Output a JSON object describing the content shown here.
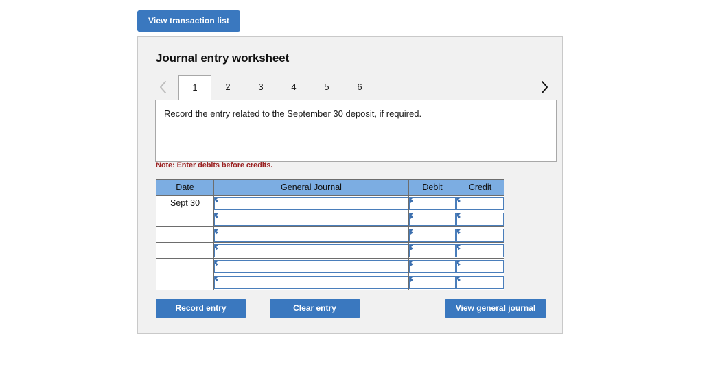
{
  "toolbar": {
    "view_transaction_list_label": "View transaction list"
  },
  "panel": {
    "title": "Journal entry worksheet",
    "note": "Note: Enter debits before credits."
  },
  "tabs": {
    "prev_icon": "chevron-left-icon",
    "next_icon": "chevron-right-icon",
    "items": [
      {
        "label": "1",
        "active": true
      },
      {
        "label": "2",
        "active": false
      },
      {
        "label": "3",
        "active": false
      },
      {
        "label": "4",
        "active": false
      },
      {
        "label": "5",
        "active": false
      },
      {
        "label": "6",
        "active": false
      }
    ]
  },
  "instruction": {
    "text": "Record the entry related to the September 30 deposit, if required."
  },
  "table": {
    "headers": [
      "Date",
      "General Journal",
      "Debit",
      "Credit"
    ],
    "rows": [
      {
        "date": "Sept 30",
        "general_journal": "",
        "debit": "",
        "credit": ""
      },
      {
        "date": "",
        "general_journal": "",
        "debit": "",
        "credit": ""
      },
      {
        "date": "",
        "general_journal": "",
        "debit": "",
        "credit": ""
      },
      {
        "date": "",
        "general_journal": "",
        "debit": "",
        "credit": ""
      },
      {
        "date": "",
        "general_journal": "",
        "debit": "",
        "credit": ""
      },
      {
        "date": "",
        "general_journal": "",
        "debit": "",
        "credit": ""
      }
    ]
  },
  "actions": {
    "record_entry_label": "Record entry",
    "clear_entry_label": "Clear entry",
    "view_general_journal_label": "View general journal"
  },
  "colors": {
    "button_blue": "#3a78bf",
    "table_header_blue": "#7cade2",
    "panel_bg": "#f1f1f1",
    "note_red": "#9b2323",
    "input_border_blue": "#4a7ebb"
  }
}
